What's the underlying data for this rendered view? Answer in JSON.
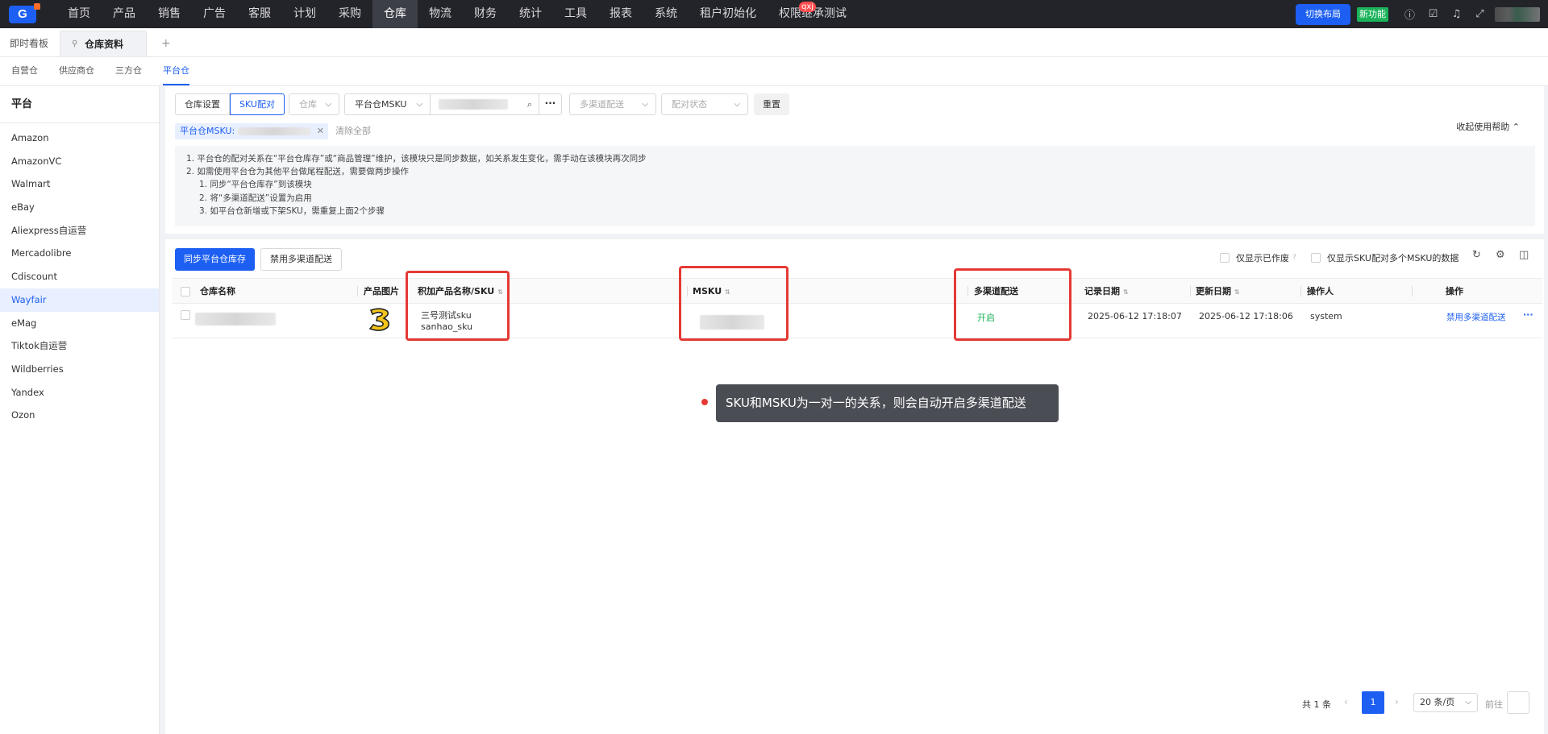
{
  "topnav": {
    "logo": "G",
    "menu": [
      "首页",
      "产品",
      "销售",
      "广告",
      "客服",
      "计划",
      "采购",
      "仓库",
      "物流",
      "财务",
      "统计",
      "工具",
      "报表",
      "系统",
      "租户初始化",
      "权限继承测试"
    ],
    "active_index": 7,
    "badge": "qxj",
    "switch_layout": "切换布局",
    "new_feature": "新功能"
  },
  "tabs": {
    "items": [
      "即时看板",
      "仓库资料"
    ],
    "active_index": 1,
    "add": "+"
  },
  "subtabs": {
    "items": [
      "自营仓",
      "供应商仓",
      "三方仓",
      "平台仓"
    ],
    "active_index": 3
  },
  "sidebar": {
    "title": "平台",
    "items": [
      "Amazon",
      "AmazonVC",
      "Walmart",
      "eBay",
      "Aliexpress自运营",
      "Mercadolibre",
      "Cdiscount",
      "Wayfair",
      "eMag",
      "Tiktok自运营",
      "Wildberries",
      "Yandex",
      "Ozon"
    ],
    "active_index": 7
  },
  "filters": {
    "seg": [
      "仓库设置",
      "SKU配对"
    ],
    "seg_active": 1,
    "warehouse_placeholder": "仓库",
    "msku_type": "平台仓MSKU",
    "multi_channel_placeholder": "多渠道配送",
    "pair_status_placeholder": "配对状态",
    "reset": "重置",
    "chip_label": "平台仓MSKU:",
    "clear_all": "清除全部",
    "collapse_help": "收起使用帮助"
  },
  "notes": [
    "1. 平台仓的配对关系在“平台仓库存”或“商品管理”维护，该模块只是同步数据，如关系发生变化，需手动在该模块再次同步",
    "2. 如需使用平台仓为其他平台做尾程配送，需要做两步操作",
    "1. 同步“平台仓库存”到该模块",
    "2. 将“多渠道配送”设置为启用",
    "3. 如平台仓新增或下架SKU，需重复上面2个步骤"
  ],
  "toolbar": {
    "sync_button": "同步平台仓库存",
    "disable_button": "禁用多渠道配送",
    "only_obsolete": "仅显示已作废",
    "only_multi_msku": "仅显示SKU配对多个MSKU的数据"
  },
  "table": {
    "headers": {
      "warehouse": "仓库名称",
      "image": "产品图片",
      "product": "积加产品名称/SKU",
      "msku": "MSKU",
      "multi_channel": "多渠道配送",
      "record_date": "记录日期",
      "update_date": "更新日期",
      "operator": "操作人",
      "action": "操作"
    },
    "rows": [
      {
        "product_name": "三号测试sku",
        "sku": "sanhao_sku",
        "multi_channel": "开启",
        "record_date": "2025-06-12 17:18:07",
        "update_date": "2025-06-12 17:18:06",
        "operator": "system",
        "action": "禁用多渠道配送",
        "more": "···"
      }
    ]
  },
  "tooltip": "SKU和MSKU为一对一的关系，则会自动开启多渠道配送",
  "pager": {
    "total": "共 1 条",
    "current": "1",
    "page_size": "20 条/页",
    "goto": "前往"
  },
  "colors": {
    "primary": "#1d5ff2",
    "topbar": "#23242a",
    "highlight": "#e53935",
    "enabled": "#1bb35a"
  }
}
